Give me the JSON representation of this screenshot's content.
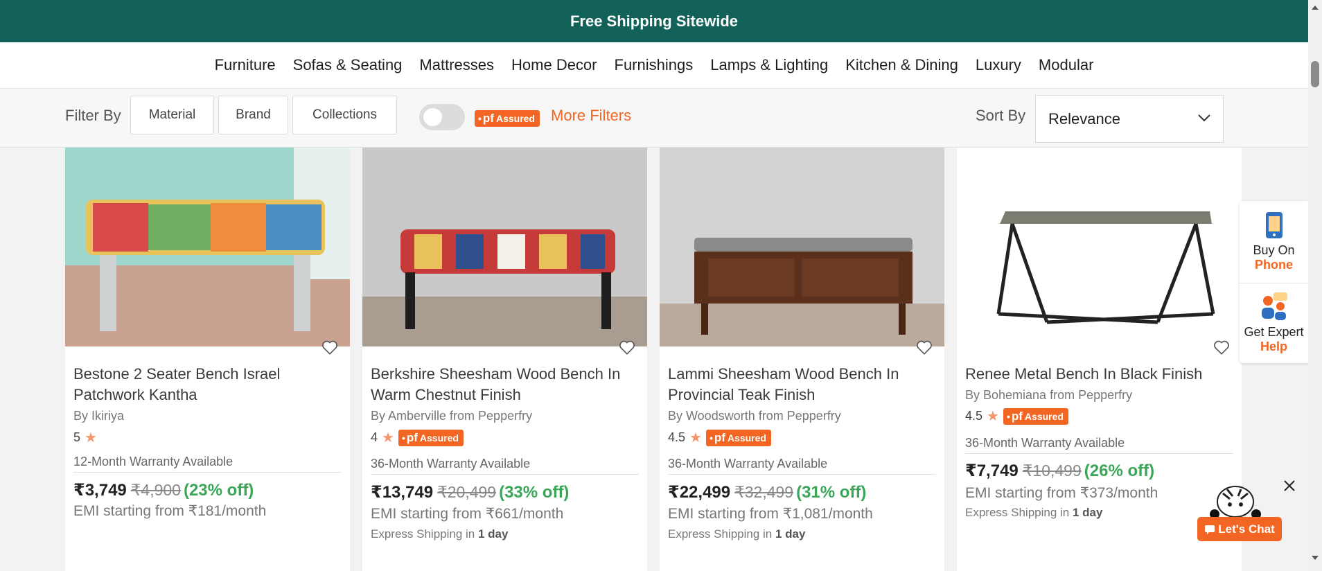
{
  "top_banner": {
    "text": "Free Shipping Sitewide"
  },
  "nav": {
    "items": [
      "Furniture",
      "Sofas & Seating",
      "Mattresses",
      "Home Decor",
      "Furnishings",
      "Lamps & Lighting",
      "Kitchen & Dining",
      "Luxury",
      "Modular"
    ]
  },
  "filters": {
    "label": "Filter By",
    "buttons": [
      "Material",
      "Brand",
      "Collections"
    ],
    "pf_toggle_on": false,
    "pf_badge": {
      "prefix": "pf",
      "text": "Assured"
    },
    "more_filters": "More Filters",
    "sort_label": "Sort By",
    "sort_value": "Relevance"
  },
  "products": [
    {
      "title": "Bestone 2 Seater Bench Israel Patchwork Kantha",
      "brand": "By Ikiriya",
      "rating": "5",
      "pf_assured": false,
      "warranty": "12-Month Warranty Available",
      "price": "₹3,749",
      "mrp": "₹4,900",
      "discount": "(23% off)",
      "emi": "EMI starting from ₹181/month",
      "shipping_prefix": "",
      "shipping_days": ""
    },
    {
      "title": "Berkshire Sheesham Wood Bench In Warm Chestnut Finish",
      "brand": "By Amberville from Pepperfry",
      "rating": "4",
      "pf_assured": true,
      "warranty": "36-Month Warranty Available",
      "price": "₹13,749",
      "mrp": "₹20,499",
      "discount": "(33% off)",
      "emi": "EMI starting from ₹661/month",
      "shipping_prefix": "Express Shipping in",
      "shipping_days": "1 day"
    },
    {
      "title": "Lammi Sheesham Wood Bench In Provincial Teak Finish",
      "brand": "By Woodsworth from Pepperfry",
      "rating": "4.5",
      "pf_assured": true,
      "warranty": "36-Month Warranty Available",
      "price": "₹22,499",
      "mrp": "₹32,499",
      "discount": "(31% off)",
      "emi": "EMI starting from ₹1,081/month",
      "shipping_prefix": "Express Shipping in",
      "shipping_days": "1 day"
    },
    {
      "title": "Renee Metal Bench In Black Finish",
      "brand": "By Bohemiana from Pepperfry",
      "rating": "4.5",
      "pf_assured": true,
      "warranty": "36-Month Warranty Available",
      "price": "₹7,749",
      "mrp": "₹10,499",
      "discount": "(26% off)",
      "emi": "EMI starting from ₹373/month",
      "shipping_prefix": "Express Shipping in",
      "shipping_days": "1 day"
    }
  ],
  "side_widget": {
    "buy_on": "Buy On",
    "phone": "Phone",
    "get_expert": "Get Expert",
    "help": "Help"
  },
  "chat": {
    "label": "Let's Chat"
  },
  "colors": {
    "brand_green": "#13625a",
    "accent_orange": "#f26522",
    "discount_green": "#3aa657"
  }
}
